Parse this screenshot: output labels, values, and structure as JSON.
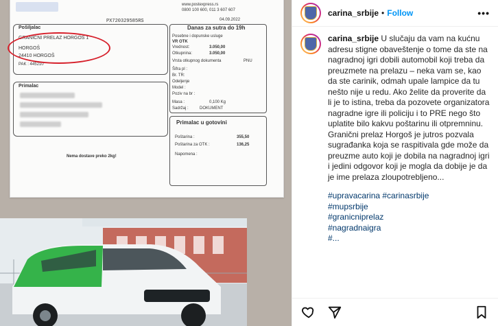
{
  "post": {
    "username": "carina_srbije",
    "separator": "•",
    "follow_label": "Follow",
    "more_label": "•••",
    "caption_text": "U slučaju da vam na kućnu adresu stigne obaveštenje o tome da ste na nagradnoj igri dobili automobil koji treba da preuzmete na prelazu – neka vam se, kao da ste carinik, odmah upale lampice da tu nešto nije u redu. Ako želite da proverite da li je to istina, treba da pozovete organizatora nagradne igre ili policiju i to PRE nego što uplatite bilo kakvu poštarinu ili otpremninu. Granični prelaz Horgoš je jutros pozvala sugrađanka koja se raspitivala gde može da preuzme auto koji je dobila na nagradnoj igri i jedini odgovor koji je mogla da dobije je da je ime prelaza zloupotrebljeno...",
    "hashtags": [
      "#upravacarina #carinasrbije",
      "#mupsrbije",
      "#granicniprelaz",
      "#nagradnaigra",
      "#..."
    ]
  },
  "document": {
    "tracking": "PX720329585RS",
    "sender_label": "Pošiljalac",
    "sender_line1": "GRANIČNI PRELAZ HORGOŠ 1",
    "sender_line2": "HORGOŠ",
    "sender_line3": "24410 HORGOŠ",
    "pak": "PAK : 445210",
    "recipient_label": "Primalac",
    "service_title": "Danas za sutra do 19h",
    "service_line": "Posebne i dopunske usluge",
    "vr_otk": "VR OTK",
    "vrednost_label": "Vrednost:",
    "vrednost": "3.050,00",
    "otkupnina_label": "Otkupnina:",
    "otkupnina": "3.050,00",
    "vrsta_label": "Vrsta otkupnog dokumenta",
    "vrsta": "PNU",
    "masa_label": "Masa :",
    "masa": "0,100 Kg",
    "sadrzaj_label": "Sadržaj :",
    "sadrzaj": "DOKUMENT",
    "cash_title": "Primalac u gotovini",
    "postarina_label": "Poštarina :",
    "postarina": "355,50",
    "postarina_otk_label": "Poštarina za OTK :",
    "postarina_otk": "136,25",
    "napomena_label": "Napomena :",
    "bottom_note": "Nema dostave preko 2kg!",
    "brand": "www.postexpress.rs",
    "phone": "0800 100 600, 011 3 607 607",
    "date": "04.09.2022",
    "field_sifra": "Šifra pl :",
    "field_brtr": "Br. TR:",
    "field_odeljenje": "Odeljenje",
    "field_model": "Model :",
    "field_poziv": "Poziv na br :"
  }
}
